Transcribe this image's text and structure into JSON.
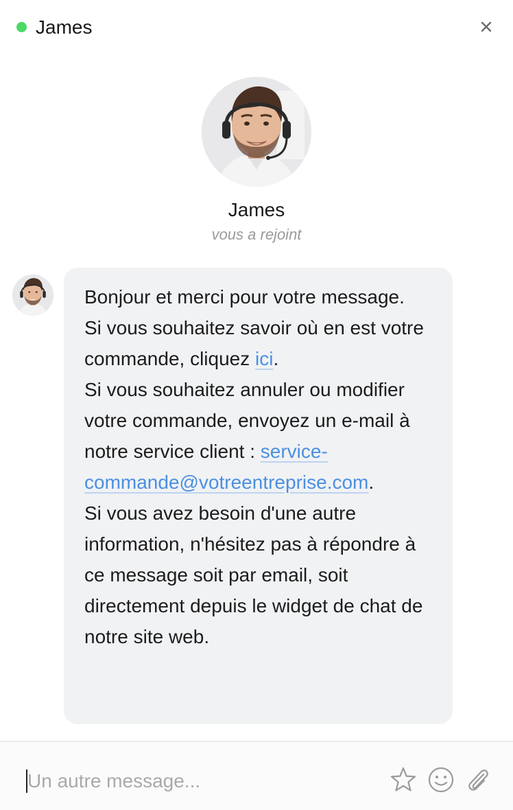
{
  "header": {
    "agent_name": "James",
    "status_color": "#4cd964",
    "close_icon": "close-icon"
  },
  "intro": {
    "agent_name": "James",
    "subtitle": "vous a rejoint"
  },
  "message": {
    "l1": "Bonjour et merci pour votre message.",
    "l2_text": "Si vous souhaitez savoir où en est votre commande, cliquez ",
    "l2_link": "ici",
    "l2_end": ".",
    "l3_text": "Si vous souhaitez annuler ou modifier votre commande, envoyez un e-mail à notre service client : ",
    "l3_link": "service-commande@votreentreprise.com",
    "l3_end": ".",
    "l4": "Si vous avez besoin d'une autre information, n'hésitez pas à répondre à ce message soit par email, soit directement depuis le widget de chat de notre site web."
  },
  "composer": {
    "placeholder": "Un autre message...",
    "icons": [
      "star-icon",
      "emoji-icon",
      "paperclip-icon"
    ]
  },
  "colors": {
    "link": "#4a90e2",
    "bubble_bg": "#f1f2f4",
    "status_online": "#4cd964"
  }
}
